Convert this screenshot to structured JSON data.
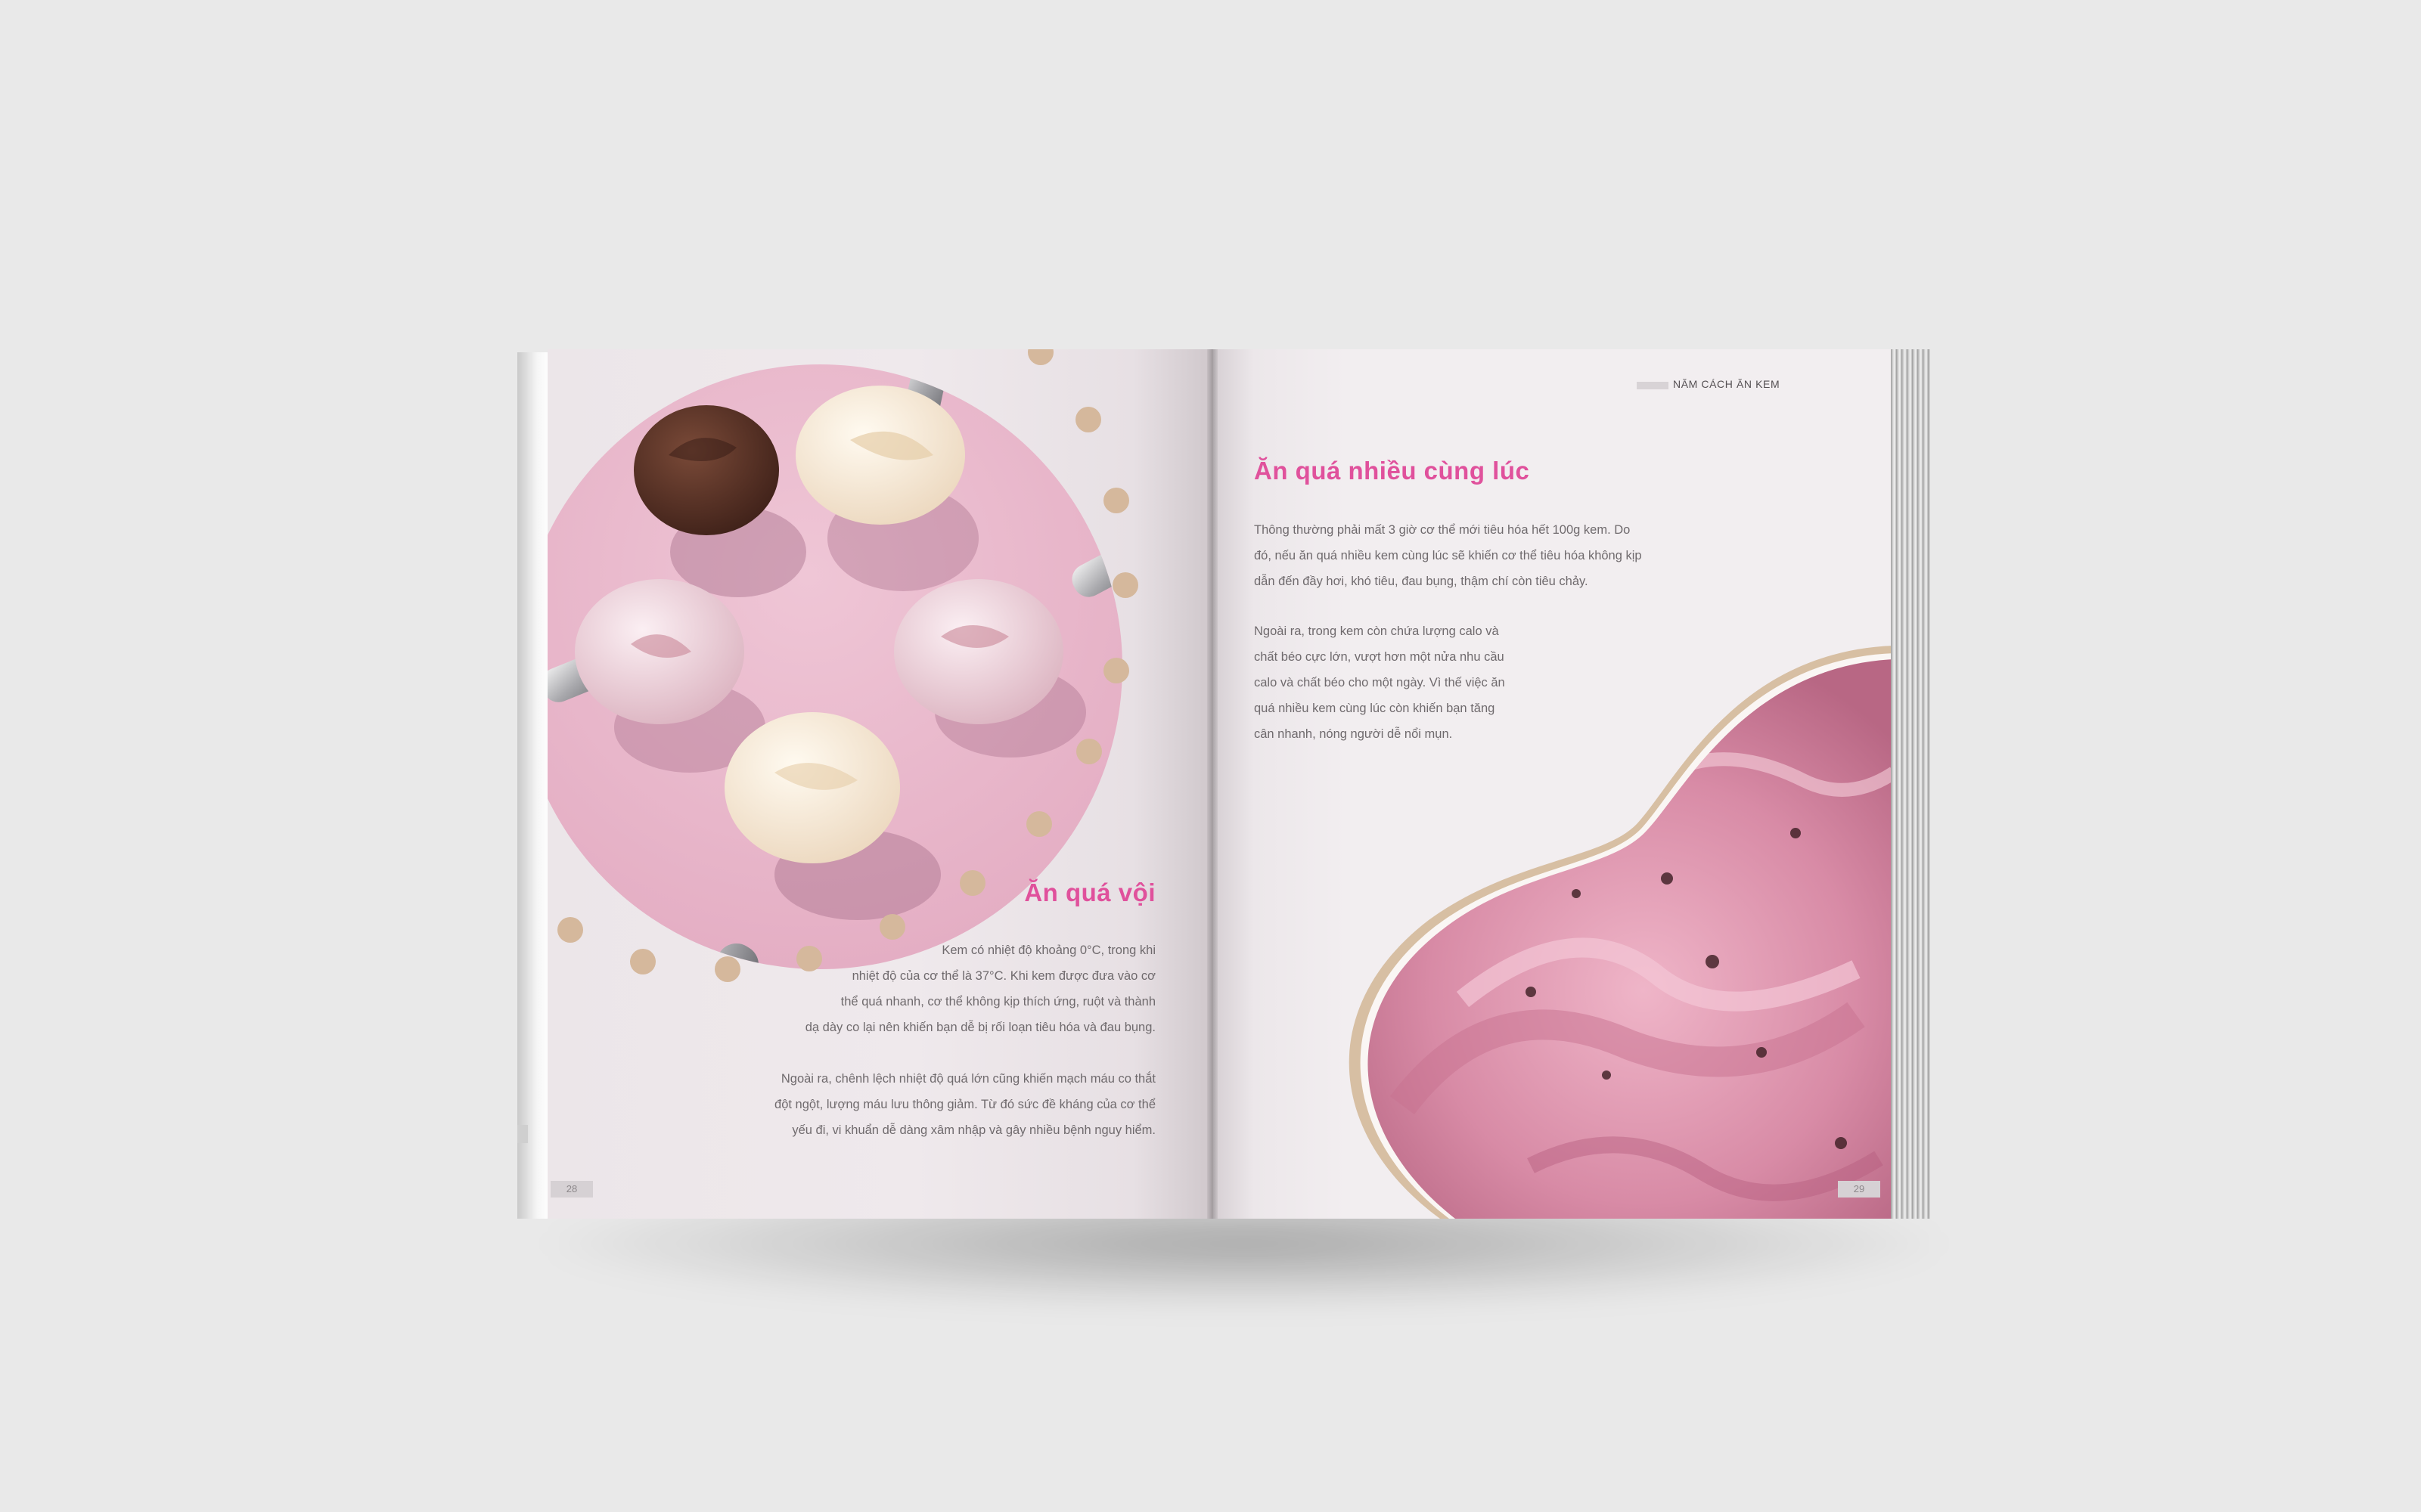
{
  "header": {
    "running_title": "NĂM CÁCH ĂN KEM"
  },
  "left_page": {
    "title": "Ăn quá vội",
    "paragraph_1": "Kem có nhiệt độ khoảng 0°C, trong khi\nnhiệt độ của cơ thể là 37°C. Khi kem được đưa vào cơ\nthể quá nhanh, cơ thể không kịp thích ứng, ruột và thành\ndạ dày co lại nên khiến bạn dễ bị rối loạn tiêu hóa và đau bụng.",
    "paragraph_2": "Ngoài ra, chênh lệch nhiệt độ quá lớn cũng khiến mạch máu co thắt\nđột ngột, lượng máu lưu thông giảm. Từ đó sức đề kháng của cơ thể\nyếu đi, vi khuẩn dễ dàng xâm nhập và gây nhiều bệnh nguy hiểm.",
    "page_number": "28"
  },
  "right_page": {
    "title": "Ăn quá nhiều cùng lúc",
    "paragraph_1": "Thông thường phải mất 3 giờ cơ thể mới tiêu hóa hết 100g kem. Do\nđó, nếu ăn quá nhiều kem cùng lúc sẽ khiến cơ thể tiêu hóa không kịp\ndẫn đến đầy hơi, khó tiêu, đau bụng, thậm chí còn tiêu chảy.",
    "paragraph_2": "Ngoài ra, trong kem còn chứa lượng calo và\nchất béo cực lớn, vượt hơn một nửa nhu cầu\ncalo và chất béo cho một ngày. Vì thế việc ăn\nquá nhiều kem cùng lúc còn khiến bạn tăng\ncân nhanh, nóng người dễ nổi mụn.",
    "page_number": "29"
  },
  "colors": {
    "accent_pink": "#e0519c",
    "body_text": "#6f6a6d",
    "dot_tan": "#d5b89c",
    "photo_pink": "#e8b8cc",
    "background": "#e9e9e9"
  }
}
